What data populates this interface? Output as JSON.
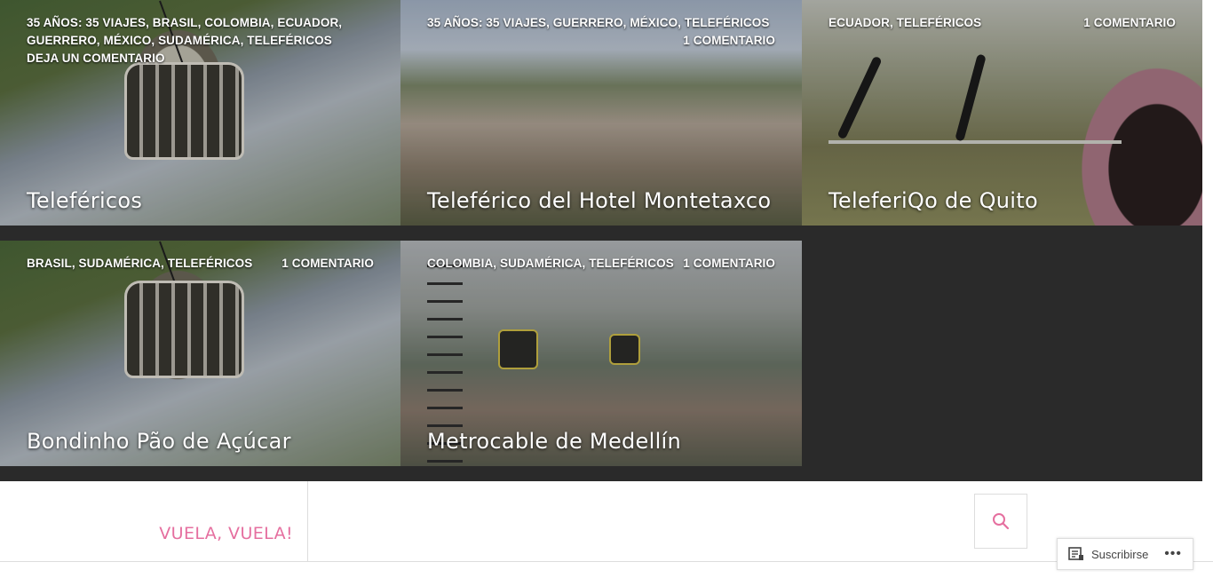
{
  "posts": [
    {
      "categories": "35 AÑOS: 35 VIAJES, BRASIL, COLOMBIA, ECUADOR, GUERRERO, MÉXICO, SUDAMÉRICA, TELEFÉRICOS",
      "comments": "DEJA UN COMENTARIO",
      "title": "Teleféricos"
    },
    {
      "categories": "35 AÑOS: 35 VIAJES, GUERRERO, MÉXICO, TELEFÉRICOS",
      "comments": "1 COMENTARIO",
      "title": "Teleférico del Hotel Montetaxco"
    },
    {
      "categories": "ECUADOR, TELEFÉRICOS",
      "comments": "1 COMENTARIO",
      "title": "TeleferiQo de Quito"
    },
    {
      "categories": "BRASIL, SUDAMÉRICA, TELEFÉRICOS",
      "comments": "1 COMENTARIO",
      "title": "Bondinho Pão de Açúcar"
    },
    {
      "categories": "COLOMBIA, SUDAMÉRICA, TELEFÉRICOS",
      "comments": "1 COMENTARIO",
      "title": "Metrocable de Medellín"
    }
  ],
  "footer": {
    "site_name": "VUELA, VUELA!",
    "search_icon": "search-icon"
  },
  "subscribe": {
    "label": "Suscribirse",
    "more": "•••"
  },
  "colors": {
    "accent": "#e56f9f",
    "grid_bg": "#2a2a2a"
  }
}
